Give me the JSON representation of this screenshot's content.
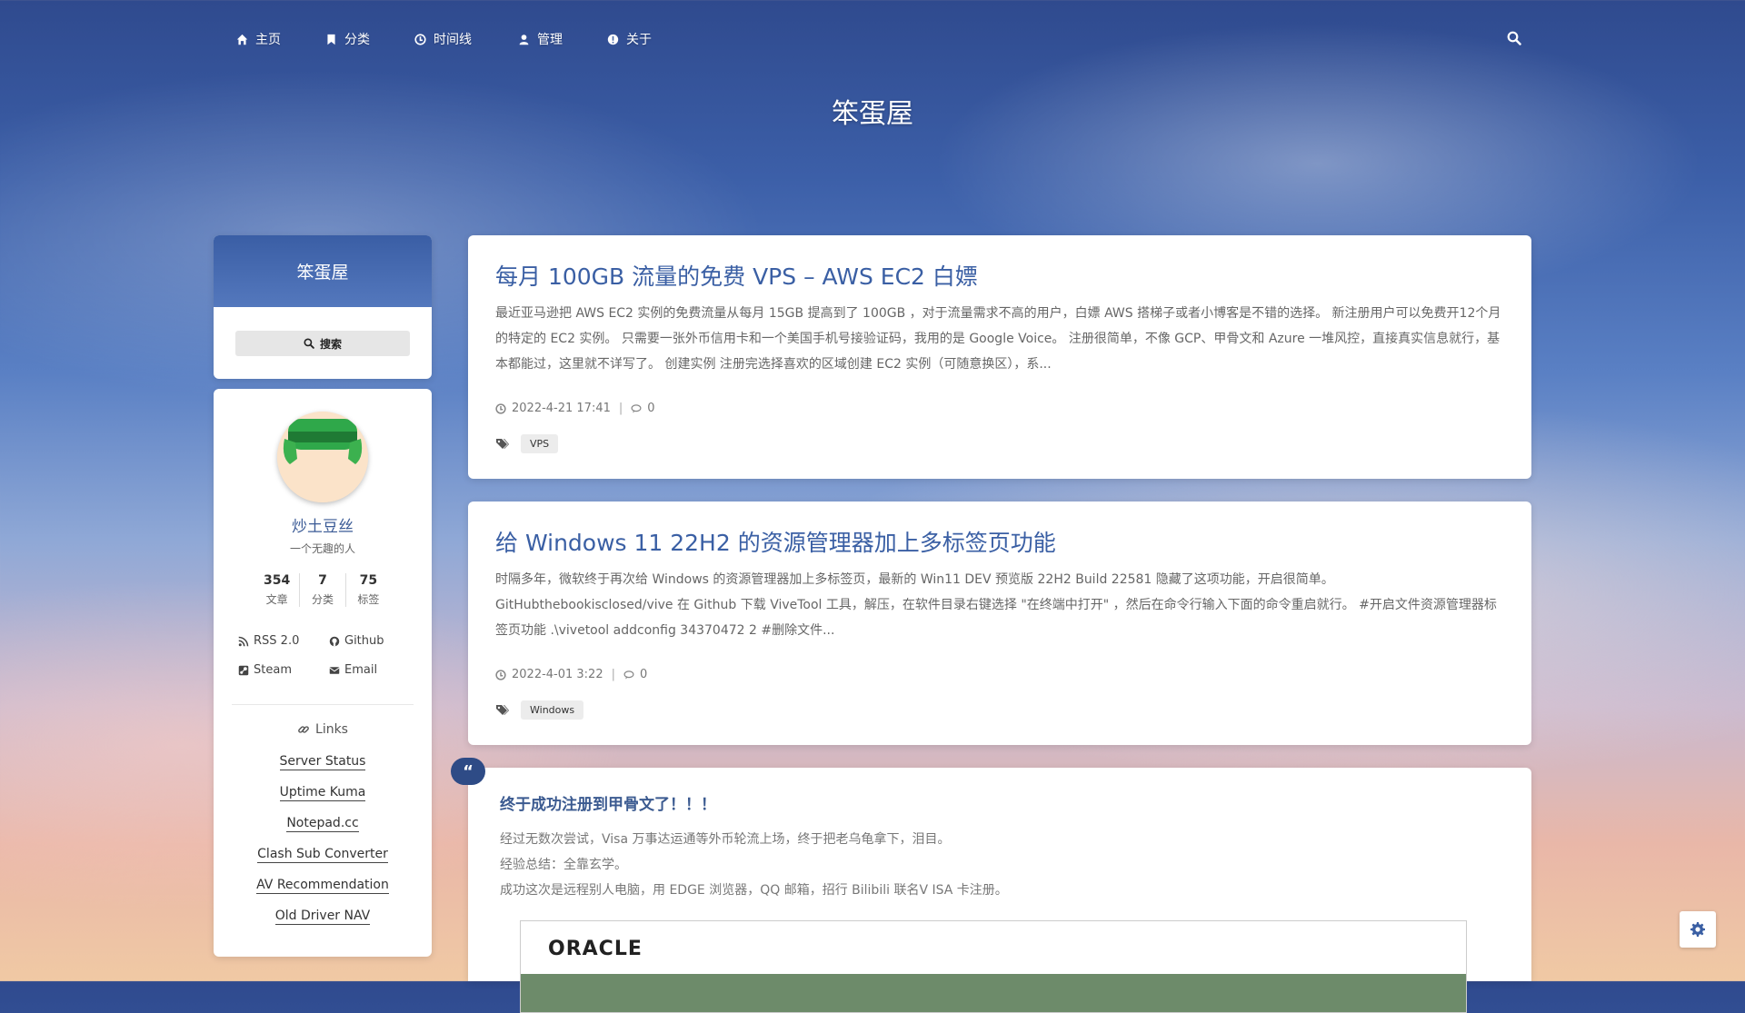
{
  "nav": {
    "items": [
      {
        "label": "主页",
        "icon": "home-icon"
      },
      {
        "label": "分类",
        "icon": "bookmark-icon"
      },
      {
        "label": "时间线",
        "icon": "clock-icon"
      },
      {
        "label": "管理",
        "icon": "user-icon"
      },
      {
        "label": "关于",
        "icon": "info-icon"
      }
    ]
  },
  "site_title": "笨蛋屋",
  "sidebar": {
    "search_card_title": "笨蛋屋",
    "search_button": "搜索",
    "profile": {
      "name": "炒土豆丝",
      "bio": "一个无趣的人",
      "stats": [
        {
          "num": "354",
          "label": "文章"
        },
        {
          "num": "7",
          "label": "分类"
        },
        {
          "num": "75",
          "label": "标签"
        }
      ],
      "social": [
        {
          "label": "RSS 2.0",
          "icon": "rss-icon"
        },
        {
          "label": "Github",
          "icon": "github-icon"
        },
        {
          "label": "Steam",
          "icon": "steam-icon"
        },
        {
          "label": "Email",
          "icon": "envelope-icon"
        }
      ],
      "links_heading": "Links",
      "links": [
        "Server Status",
        "Uptime Kuma",
        "Notepad.cc",
        "Clash Sub Converter",
        "AV Recommendation",
        "Old Driver NAV"
      ]
    }
  },
  "posts": [
    {
      "title": "每月 100GB 流量的免费 VPS – AWS EC2 白嫖",
      "excerpt": "最近亚马逊把 AWS EC2 实例的免费流量从每月 15GB 提高到了 100GB ，对于流量需求不高的用户，白嫖 AWS 搭梯子或者小博客是不错的选择。 新注册用户可以免费开12个月的特定的 EC2 实例。 只需要一张外币信用卡和一个美国手机号接验证码，我用的是 Google Voice。 注册很简单，不像 GCP、甲骨文和 Azure 一堆风控，直接真实信息就行，基本都能过，这里就不详写了。 创建实例 注册完选择喜欢的区域创建 EC2 实例（可随意换区），系...",
      "date": "2022-4-21 17:41",
      "comments": "0",
      "tag": "VPS"
    },
    {
      "title": "给 Windows 11 22H2 的资源管理器加上多标签页功能",
      "excerpt": "时隔多年，微软终于再次给 Windows 的资源管理器加上多标签页，最新的 Win11 DEV 预览版 22H2 Build 22581 隐藏了这项功能，开启很简单。 GitHubthebookisclosed/vive 在 Github 下载 ViveTool 工具，解压，在软件目录右键选择 \"在终端中打开\" ，然后在命令行输入下面的命令重启就行。 #开启文件资源管理器标签页功能 .\\vivetool addconfig 34370472 2 #删除文件...",
      "date": "2022-4-01 3:22",
      "comments": "0",
      "tag": "Windows"
    }
  ],
  "quote_post": {
    "badge": "“",
    "title": "终于成功注册到甲骨文了！！！",
    "lines": [
      "经过无数次尝试，Visa 万事达运通等外币轮流上场，终于把老乌龟拿下，泪目。",
      "经验总结：全靠玄学。",
      "成功这次是远程别人电脑，用 EDGE 浏览器，QQ 邮箱，招行 Bilibili 联名V ISA 卡注册。"
    ],
    "image_logo": "ORACLE"
  }
}
